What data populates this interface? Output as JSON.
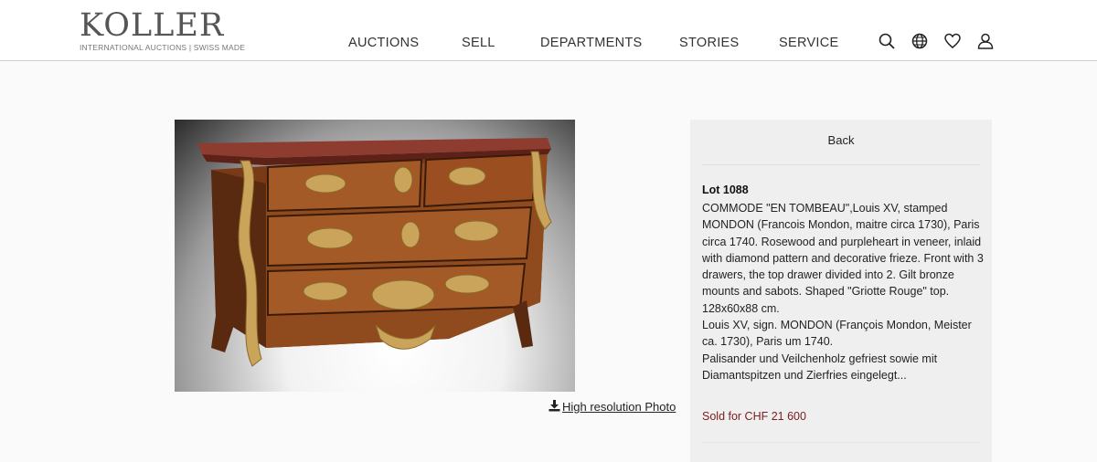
{
  "brand": {
    "name": "KOLLER",
    "tagline": "INTERNATIONAL AUCTIONS | SWISS MADE"
  },
  "nav": {
    "items": [
      {
        "label": "AUCTIONS"
      },
      {
        "label": "SELL"
      },
      {
        "label": "DEPARTMENTS"
      },
      {
        "label": "STORIES"
      },
      {
        "label": "SERVICE"
      }
    ]
  },
  "header_icons": [
    "search-icon",
    "globe-icon",
    "heart-icon",
    "user-icon"
  ],
  "photo": {
    "download_label": "High resolution Photo"
  },
  "lot_panel": {
    "back_label": "Back",
    "lot_number": "Lot 1088",
    "description_en": "COMMODE \"EN TOMBEAU\",Louis XV, stamped MONDON (Francois Mondon, maitre circa 1730), Paris circa 1740. Rosewood and purpleheart in veneer, inlaid with diamond pattern and decorative frieze. Front with 3 drawers, the top drawer divided into 2. Gilt bronze mounts and sabots. Shaped \"Griotte Rouge\" top. 128x60x88 cm.",
    "description_de_1": "Louis XV, sign. MONDON (François Mondon, Meister ca. 1730), Paris um 1740.",
    "description_de_2": "Palisander und Veilchenholz gefriest sowie mit Diamantspitzen und Zierfries eingelegt...",
    "sold_text": "Sold for CHF 21 600"
  },
  "colors": {
    "sold": "#7a1c1c",
    "panel_bg": "#efefef",
    "header_border": "#cfcfcf"
  }
}
